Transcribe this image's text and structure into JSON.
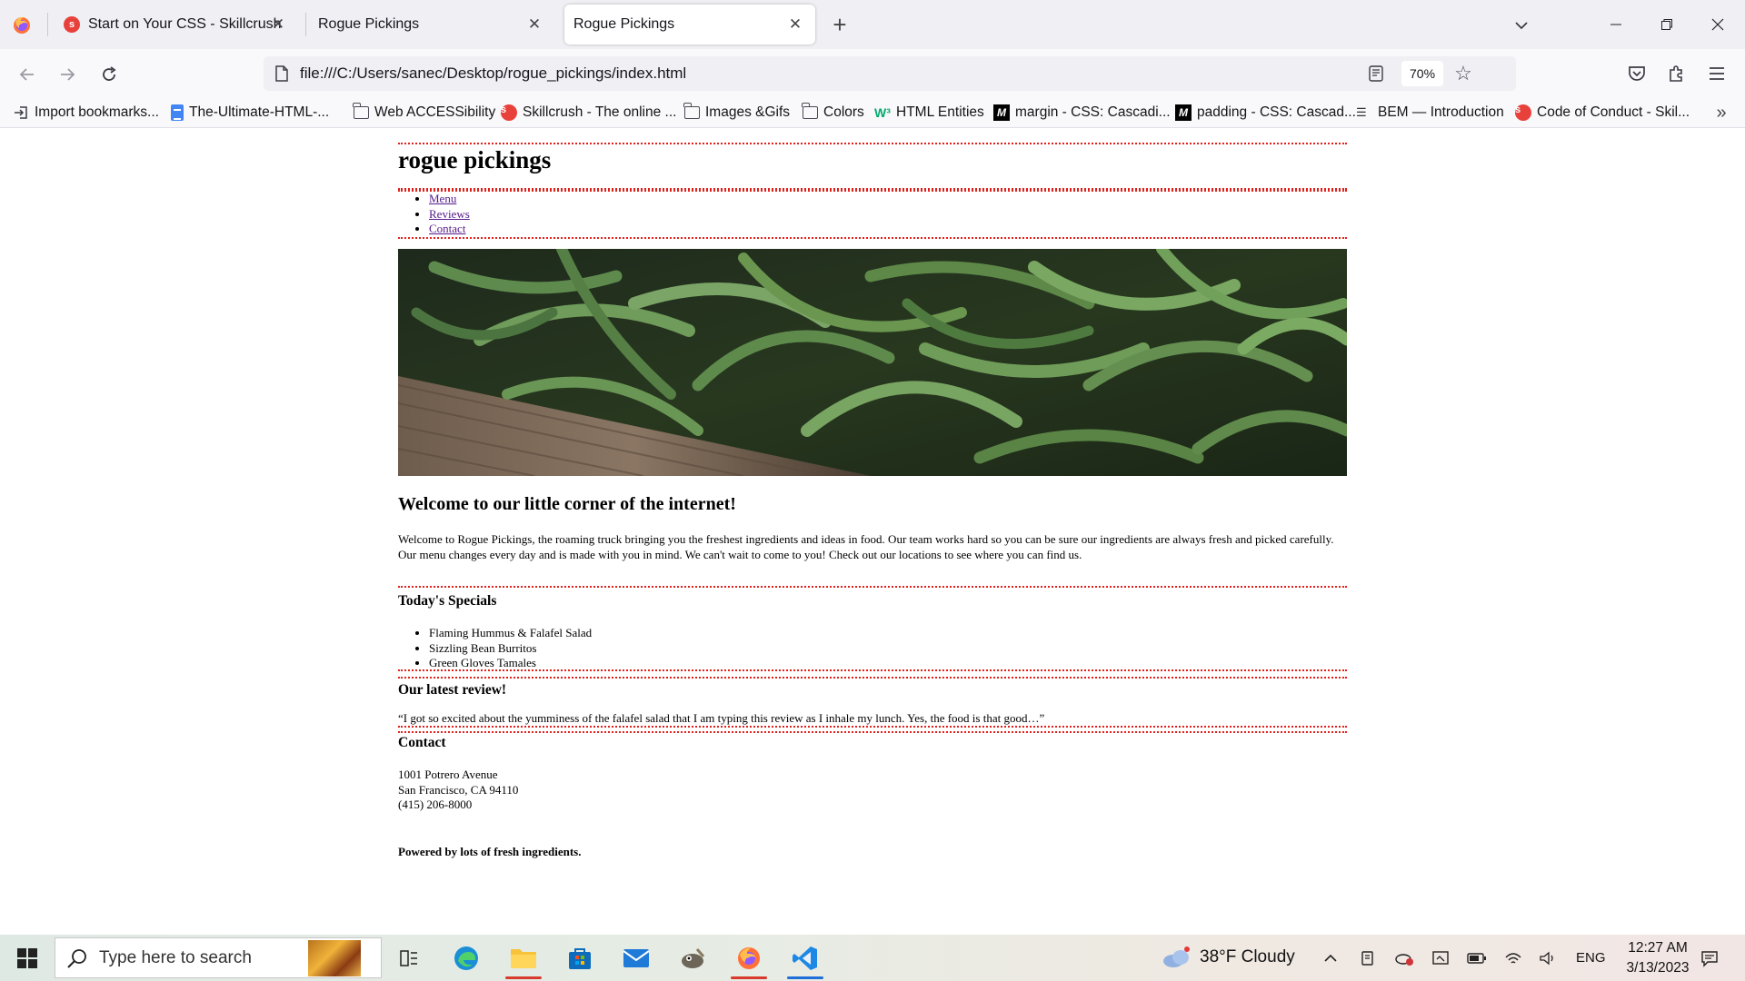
{
  "browser": {
    "tabs": [
      {
        "title": "Start on Your CSS - Skillcrush",
        "favicon": "skillcrush-icon",
        "active": false
      },
      {
        "title": "Rogue Pickings",
        "favicon": "none",
        "active": false
      },
      {
        "title": "Rogue Pickings",
        "favicon": "none",
        "active": true
      }
    ],
    "url": "file:///C:/Users/sanec/Desktop/rogue_pickings/index.html",
    "zoom": "70%",
    "bookmarks": [
      {
        "label": "Import bookmarks...",
        "icon": "import-icon"
      },
      {
        "label": "The-Ultimate-HTML-...",
        "icon": "doc-icon"
      },
      {
        "label": "Web ACCESSibility",
        "icon": "folder-icon"
      },
      {
        "label": "Skillcrush - The online ...",
        "icon": "skillcrush-icon"
      },
      {
        "label": "Images &Gifs",
        "icon": "folder-icon"
      },
      {
        "label": "Colors",
        "icon": "folder-icon"
      },
      {
        "label": "HTML Entities",
        "icon": "w3schools-icon"
      },
      {
        "label": "margin - CSS: Cascadi...",
        "icon": "mdn-icon"
      },
      {
        "label": "padding - CSS: Cascad...",
        "icon": "mdn-icon"
      },
      {
        "label": "BEM — Introduction",
        "icon": "bem-icon"
      },
      {
        "label": "Code of Conduct - Skil...",
        "icon": "skillcrush-icon"
      }
    ]
  },
  "page": {
    "site_title": "rogue pickings",
    "nav": [
      "Menu",
      "Reviews",
      "Contact"
    ],
    "hero_alt": "green beans",
    "welcome_title": "Welcome to our little corner of the internet!",
    "welcome_text": "Welcome to Rogue Pickings, the roaming truck bringing you the freshest ingredients and ideas in food. Our team works hard so you can be sure our ingredients are always fresh and picked carefully. Our menu changes every day and is made with you in mind. We can't wait to come to you! Check out our locations to see where you can find us.",
    "specials_title": "Today's Specials",
    "specials": [
      "Flaming Hummus & Falafel Salad",
      "Sizzling Bean Burritos",
      "Green Gloves Tamales"
    ],
    "review_title": "Our latest review!",
    "review_text": "“I got so excited about the yumminess of the falafel salad that I am typing this review as I inhale my lunch. Yes, the food is that good…”",
    "contact_title": "Contact",
    "address_lines": [
      "1001 Potrero Avenue",
      "San Francisco, CA 94110",
      "(415) 206-8000"
    ],
    "footer": "Powered by lots of fresh ingredients.",
    "border_color": "#e0201a",
    "link_color": "#551a8b"
  },
  "taskbar": {
    "search_placeholder": "Type here to search",
    "weather": "38°F  Cloudy",
    "language": "ENG",
    "time": "12:27 AM",
    "date": "3/13/2023"
  }
}
